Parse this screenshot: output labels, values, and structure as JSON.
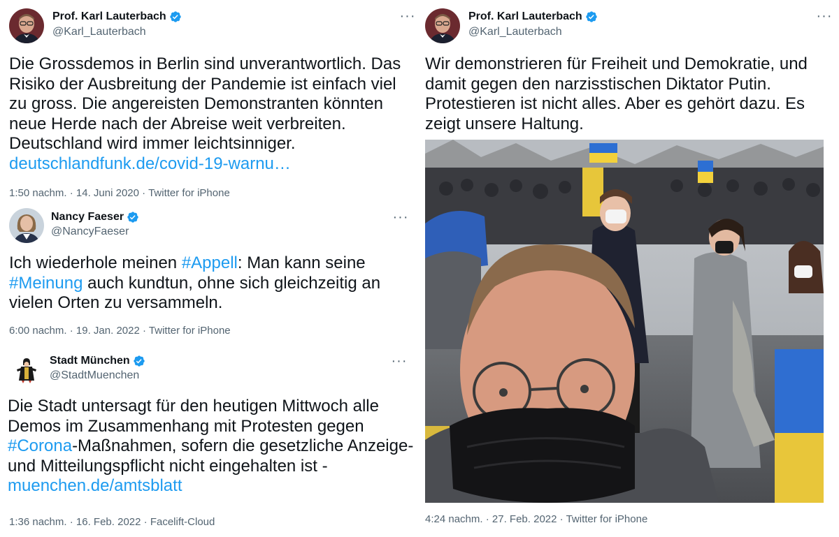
{
  "tweets": [
    {
      "name": "Prof. Karl Lauterbach",
      "handle": "@Karl_Lauterbach",
      "text_plain": "Die Grossdemos in Berlin sind unverantwortlich. Das Risiko der Ausbreitung der Pandemie ist einfach viel zu gross. Die angereisten Demonstranten könnten neue Herde nach der Abreise weit verbreiten. Deutschland wird immer leichtsinniger. ",
      "link": "deutschlandfunk.de/covid-19-warnu…",
      "time": "1:50 nachm.",
      "date": "14. Juni 2020",
      "source": "Twitter for iPhone"
    },
    {
      "name": "Nancy Faeser",
      "handle": "@NancyFaeser",
      "text_1": "Ich wiederhole meinen ",
      "hashtag_1": "#Appell",
      "text_2": ": Man kann seine ",
      "hashtag_2": "#Meinung",
      "text_3": " auch kundtun, ohne sich gleichzeitig an vielen Orten zu versammeln.",
      "time": "6:00 nachm.",
      "date": "19. Jan. 2022",
      "source": "Twitter for iPhone"
    },
    {
      "name": "Stadt München",
      "handle": "@StadtMuenchen",
      "text_1": "Die Stadt untersagt für den heutigen Mittwoch alle Demos im Zusammenhang mit Protesten gegen ",
      "hashtag_1": "#Corona",
      "text_2": "-Maßnahmen, sofern die gesetzliche Anzeige- und Mitteilungspflicht nicht eingehalten ist - ",
      "link": "muenchen.de/amtsblatt",
      "time": "1:36 nachm.",
      "date": "16. Feb. 2022",
      "source": "Facelift-Cloud"
    },
    {
      "name": "Prof. Karl Lauterbach",
      "handle": "@Karl_Lauterbach",
      "text_plain": "Wir demonstrieren für Freiheit und Demokratie, und damit gegen den narzisstischen Diktator Putin. Protestieren ist nicht alles. Aber es gehört dazu. Es zeigt unsere Haltung.",
      "time": "4:24 nachm.",
      "date": "27. Feb. 2022",
      "source": "Twitter for iPhone"
    }
  ],
  "separator": "·",
  "more_glyph": "···",
  "colors": {
    "text": "#0f1419",
    "secondary": "#536471",
    "link": "#1d9bf0",
    "verified": "#1d9bf0"
  }
}
